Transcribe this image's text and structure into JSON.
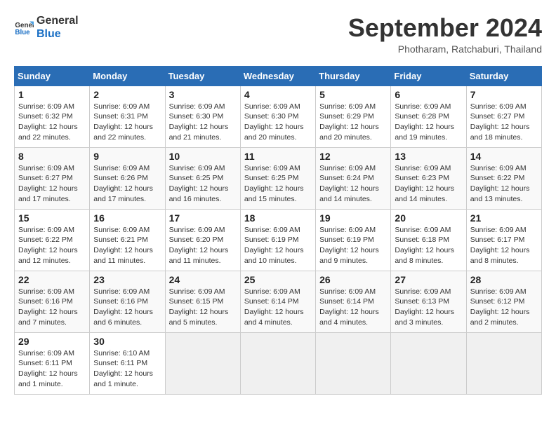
{
  "header": {
    "logo_line1": "General",
    "logo_line2": "Blue",
    "month_year": "September 2024",
    "location": "Photharam, Ratchaburi, Thailand"
  },
  "weekdays": [
    "Sunday",
    "Monday",
    "Tuesday",
    "Wednesday",
    "Thursday",
    "Friday",
    "Saturday"
  ],
  "weeks": [
    [
      {
        "day": "1",
        "sunrise": "6:09 AM",
        "sunset": "6:32 PM",
        "daylight": "12 hours and 22 minutes."
      },
      {
        "day": "2",
        "sunrise": "6:09 AM",
        "sunset": "6:31 PM",
        "daylight": "12 hours and 22 minutes."
      },
      {
        "day": "3",
        "sunrise": "6:09 AM",
        "sunset": "6:30 PM",
        "daylight": "12 hours and 21 minutes."
      },
      {
        "day": "4",
        "sunrise": "6:09 AM",
        "sunset": "6:30 PM",
        "daylight": "12 hours and 20 minutes."
      },
      {
        "day": "5",
        "sunrise": "6:09 AM",
        "sunset": "6:29 PM",
        "daylight": "12 hours and 20 minutes."
      },
      {
        "day": "6",
        "sunrise": "6:09 AM",
        "sunset": "6:28 PM",
        "daylight": "12 hours and 19 minutes."
      },
      {
        "day": "7",
        "sunrise": "6:09 AM",
        "sunset": "6:27 PM",
        "daylight": "12 hours and 18 minutes."
      }
    ],
    [
      {
        "day": "8",
        "sunrise": "6:09 AM",
        "sunset": "6:27 PM",
        "daylight": "12 hours and 17 minutes."
      },
      {
        "day": "9",
        "sunrise": "6:09 AM",
        "sunset": "6:26 PM",
        "daylight": "12 hours and 17 minutes."
      },
      {
        "day": "10",
        "sunrise": "6:09 AM",
        "sunset": "6:25 PM",
        "daylight": "12 hours and 16 minutes."
      },
      {
        "day": "11",
        "sunrise": "6:09 AM",
        "sunset": "6:25 PM",
        "daylight": "12 hours and 15 minutes."
      },
      {
        "day": "12",
        "sunrise": "6:09 AM",
        "sunset": "6:24 PM",
        "daylight": "12 hours and 14 minutes."
      },
      {
        "day": "13",
        "sunrise": "6:09 AM",
        "sunset": "6:23 PM",
        "daylight": "12 hours and 14 minutes."
      },
      {
        "day": "14",
        "sunrise": "6:09 AM",
        "sunset": "6:22 PM",
        "daylight": "12 hours and 13 minutes."
      }
    ],
    [
      {
        "day": "15",
        "sunrise": "6:09 AM",
        "sunset": "6:22 PM",
        "daylight": "12 hours and 12 minutes."
      },
      {
        "day": "16",
        "sunrise": "6:09 AM",
        "sunset": "6:21 PM",
        "daylight": "12 hours and 11 minutes."
      },
      {
        "day": "17",
        "sunrise": "6:09 AM",
        "sunset": "6:20 PM",
        "daylight": "12 hours and 11 minutes."
      },
      {
        "day": "18",
        "sunrise": "6:09 AM",
        "sunset": "6:19 PM",
        "daylight": "12 hours and 10 minutes."
      },
      {
        "day": "19",
        "sunrise": "6:09 AM",
        "sunset": "6:19 PM",
        "daylight": "12 hours and 9 minutes."
      },
      {
        "day": "20",
        "sunrise": "6:09 AM",
        "sunset": "6:18 PM",
        "daylight": "12 hours and 8 minutes."
      },
      {
        "day": "21",
        "sunrise": "6:09 AM",
        "sunset": "6:17 PM",
        "daylight": "12 hours and 8 minutes."
      }
    ],
    [
      {
        "day": "22",
        "sunrise": "6:09 AM",
        "sunset": "6:16 PM",
        "daylight": "12 hours and 7 minutes."
      },
      {
        "day": "23",
        "sunrise": "6:09 AM",
        "sunset": "6:16 PM",
        "daylight": "12 hours and 6 minutes."
      },
      {
        "day": "24",
        "sunrise": "6:09 AM",
        "sunset": "6:15 PM",
        "daylight": "12 hours and 5 minutes."
      },
      {
        "day": "25",
        "sunrise": "6:09 AM",
        "sunset": "6:14 PM",
        "daylight": "12 hours and 4 minutes."
      },
      {
        "day": "26",
        "sunrise": "6:09 AM",
        "sunset": "6:14 PM",
        "daylight": "12 hours and 4 minutes."
      },
      {
        "day": "27",
        "sunrise": "6:09 AM",
        "sunset": "6:13 PM",
        "daylight": "12 hours and 3 minutes."
      },
      {
        "day": "28",
        "sunrise": "6:09 AM",
        "sunset": "6:12 PM",
        "daylight": "12 hours and 2 minutes."
      }
    ],
    [
      {
        "day": "29",
        "sunrise": "6:09 AM",
        "sunset": "6:11 PM",
        "daylight": "12 hours and 1 minute."
      },
      {
        "day": "30",
        "sunrise": "6:10 AM",
        "sunset": "6:11 PM",
        "daylight": "12 hours and 1 minute."
      },
      null,
      null,
      null,
      null,
      null
    ]
  ]
}
